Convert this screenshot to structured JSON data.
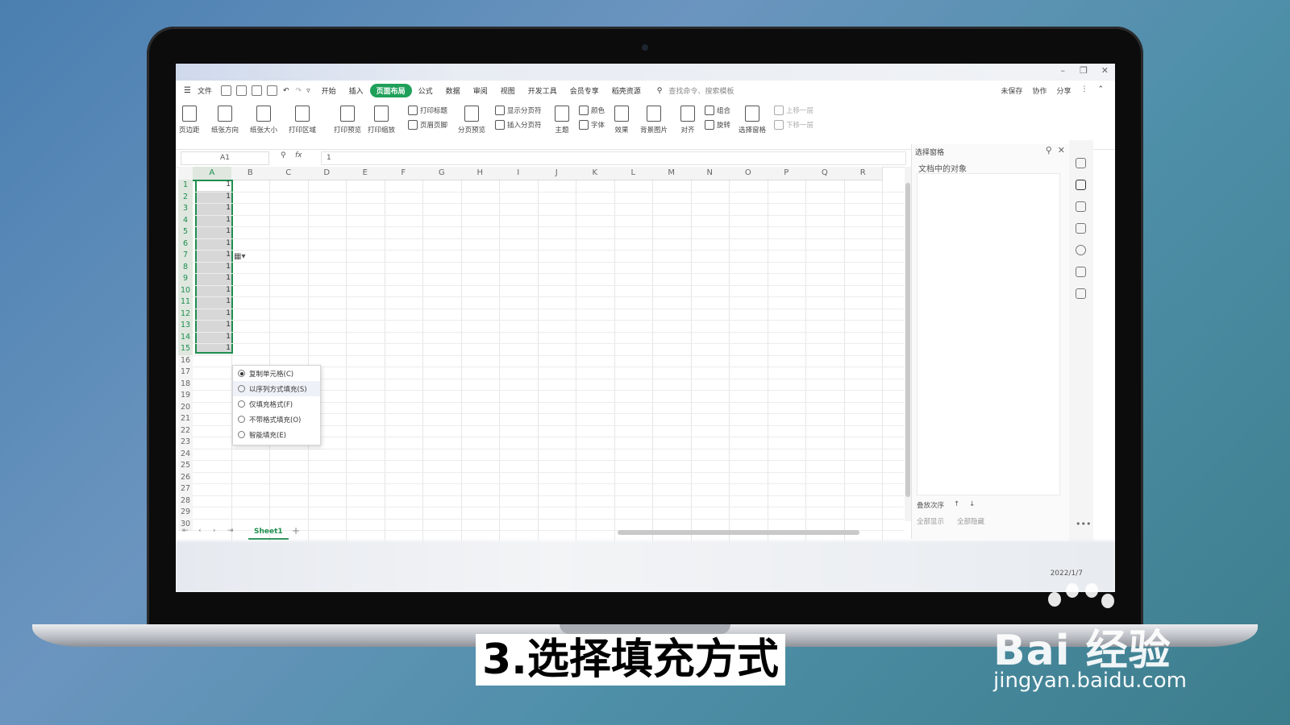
{
  "menu": {
    "file": "文件",
    "tabs": [
      "开始",
      "插入",
      "页面布局",
      "公式",
      "数据",
      "审阅",
      "视图",
      "开发工具",
      "会员专享",
      "稻壳资源"
    ],
    "active_tab": "页面布局",
    "search": "查找命令、搜索模板",
    "actions": [
      "未保存",
      "协作",
      "分享"
    ]
  },
  "ribbon": {
    "margins": "页边距",
    "orientation": "纸张方向",
    "size": "纸张大小",
    "print_area": "打印区域",
    "print_preview": "打印预览",
    "print_scale": "打印缩放",
    "print_titles": "打印标题",
    "header_footer": "页眉页脚",
    "page_break_preview": "分页预览",
    "show_page_breaks": "显示分页符",
    "insert_page_break": "插入分页符",
    "theme": "主题",
    "colors": "颜色",
    "fonts": "字体",
    "effects": "效果",
    "background": "背景图片",
    "align": "对齐",
    "group": "组合",
    "rotate": "旋转",
    "selection_pane": "选择窗格",
    "bring_forward": "上移一层",
    "send_backward": "下移一层"
  },
  "formula": {
    "cell_ref": "A1",
    "fx": "fx",
    "value": "1"
  },
  "grid": {
    "columns": [
      "A",
      "B",
      "C",
      "D",
      "E",
      "F",
      "G",
      "H",
      "I",
      "J",
      "K",
      "L",
      "M",
      "N",
      "O",
      "P",
      "Q",
      "R"
    ],
    "rows": [
      "1",
      "2",
      "3",
      "4",
      "5",
      "6",
      "7",
      "8",
      "9",
      "10",
      "11",
      "12",
      "13",
      "14",
      "15",
      "16",
      "17",
      "18",
      "19",
      "20",
      "21",
      "22",
      "23",
      "24",
      "25",
      "26",
      "27",
      "28",
      "29",
      "30"
    ],
    "col_a_values": [
      "1",
      "1",
      "1",
      "1",
      "1",
      "1",
      "1",
      "1",
      "1",
      "1",
      "1",
      "1",
      "1",
      "1",
      "1"
    ]
  },
  "fill_options": {
    "items": [
      {
        "label": "复制单元格(C)",
        "selected": true
      },
      {
        "label": "以序列方式填充(S)",
        "selected": false
      },
      {
        "label": "仅填充格式(F)",
        "selected": false
      },
      {
        "label": "不带格式填充(O)",
        "selected": false
      },
      {
        "label": "智能填充(E)",
        "selected": false
      }
    ]
  },
  "sheet": {
    "tab": "Sheet1",
    "add": "+"
  },
  "panel": {
    "title": "选择窗格",
    "subtitle": "文档中的对象",
    "order_label": "叠放次序",
    "show_all": "全部显示",
    "hide_all": "全部隐藏"
  },
  "taskbar": {
    "date": "2022/1/7"
  },
  "caption": "3.选择填充方式",
  "watermark": {
    "brand": "Bai 经验",
    "url": "jingyan.baidu.com"
  }
}
